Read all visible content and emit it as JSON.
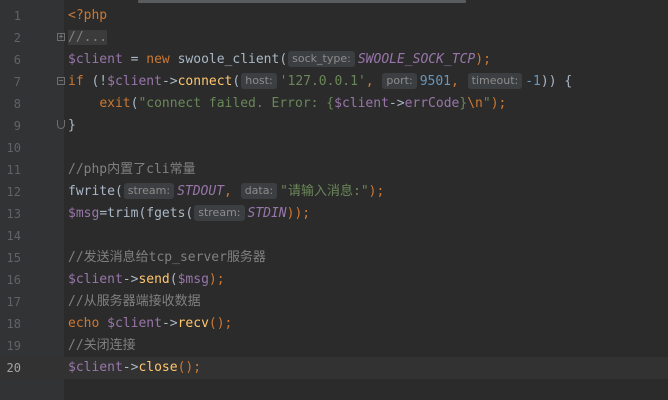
{
  "editor": {
    "lines": [
      {
        "num": "1"
      },
      {
        "num": "2"
      },
      {
        "num": "6"
      },
      {
        "num": "7"
      },
      {
        "num": "8"
      },
      {
        "num": "9"
      },
      {
        "num": "10"
      },
      {
        "num": "11"
      },
      {
        "num": "12"
      },
      {
        "num": "13"
      },
      {
        "num": "14"
      },
      {
        "num": "15"
      },
      {
        "num": "16"
      },
      {
        "num": "17"
      },
      {
        "num": "18"
      },
      {
        "num": "19"
      },
      {
        "num": "20"
      }
    ],
    "t": {
      "php_open": "<?php",
      "folded": "//...",
      "client_var": "$client",
      "eq": " = ",
      "new_kw": "new",
      "swoole_client": " swoole_client(",
      "hint_sock_type": "sock_type:",
      "sock_const": "SWOOLE_SOCK_TCP",
      "close_semi": ");",
      "if_kw": "if",
      "if_open": " (!",
      "arrow": "->",
      "connect_fn": "connect",
      "paren_open": "(",
      "hint_host": "host:",
      "host_str": "'127.0.0.1'",
      "comma": ", ",
      "hint_port": "port:",
      "port_num": "9501",
      "hint_timeout": "timeout:",
      "timeout_num": "-1",
      "if_close": ")) {",
      "indent": "    ",
      "exit_kw": "exit",
      "exit_str_a": "\"connect failed. Error: {",
      "errcode": "errCode",
      "exit_str_b": "}",
      "newline_esc": "\\n",
      "exit_str_c": "\"",
      "brace_close": "}",
      "cmt_cli": "//php内置了cli常量",
      "fwrite": "fwrite(",
      "hint_stream": "stream:",
      "stdout_const": "STDOUT",
      "hint_data": "data:",
      "prompt_str": "\"请输入消息:\"",
      "msg_var": "$msg",
      "trim_fgets": "=trim(fgets(",
      "stdin_const": "STDIN",
      "close_double": "));",
      "cmt_send": "//发送消息给tcp_server服务器",
      "send_fn": "send",
      "cmt_recv": "//从服务器端接收数据",
      "echo_kw": "echo",
      "space": " ",
      "recv_fn": "recv",
      "empty_call": "();",
      "cmt_close": "//关闭连接",
      "close_fn": "close"
    }
  }
}
